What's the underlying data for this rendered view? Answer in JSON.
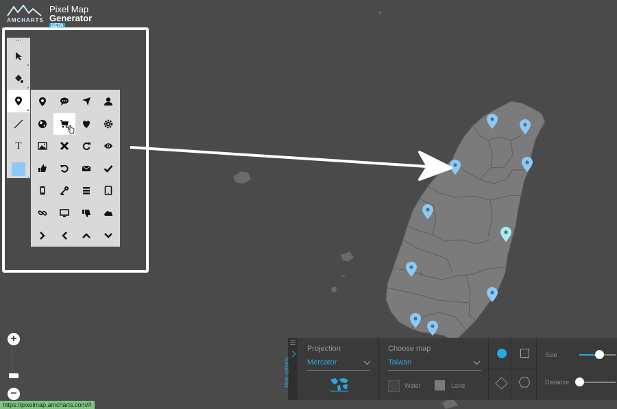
{
  "logo": {
    "brand": "AMCHARTS",
    "line1": "Pixel Map",
    "line2": "Generator",
    "badge": "BETA"
  },
  "toolbar": {
    "tools": [
      "pointer-tool",
      "fill-tool",
      "marker-tool",
      "line-tool",
      "text-tool",
      "color-swatch"
    ],
    "text_tool_label": "T",
    "swatch_color": "#8ec8f4"
  },
  "icon_grid": {
    "icons": [
      "map-marker-icon",
      "comment-icon",
      "location-arrow-icon",
      "user-icon",
      "globe-icon",
      "shopping-cart-icon",
      "heart-icon",
      "cog-icon",
      "picture-icon",
      "remove-icon",
      "refresh-icon",
      "eye-icon",
      "thumbs-up-icon",
      "undo-icon",
      "envelope-icon",
      "check-icon",
      "phone-icon",
      "key-icon",
      "list-icon",
      "tablet-icon",
      "link-icon",
      "monitor-icon",
      "thumbs-down-icon",
      "cloud-icon",
      "chevron-right-icon",
      "chevron-left-icon",
      "chevron-up-icon",
      "chevron-down-icon"
    ],
    "selected": "shopping-cart-icon"
  },
  "map": {
    "land_color": "#7b7b7b",
    "background": "#4a4a4a",
    "marker_color": "#8ec8f4",
    "marker_highlight": "#a9e8ee",
    "marker_count": 10
  },
  "zoom": {
    "in": "+",
    "out": "−"
  },
  "status_url": "https://pixelmap.amcharts.com/#",
  "options": {
    "toggle_label": "Hide options",
    "projection": {
      "title": "Projection",
      "value": "Mercator"
    },
    "choose_map": {
      "title": "Choose map",
      "value": "Taiwan"
    },
    "water_label": "Water",
    "land_label": "Land",
    "water_color": "#444444",
    "land_color": "#7b7b7b",
    "size_label": "Size",
    "distance_label": "Distance",
    "size_value": 0.55,
    "distance_value": 0.0,
    "accent": "#2aa6e0"
  }
}
